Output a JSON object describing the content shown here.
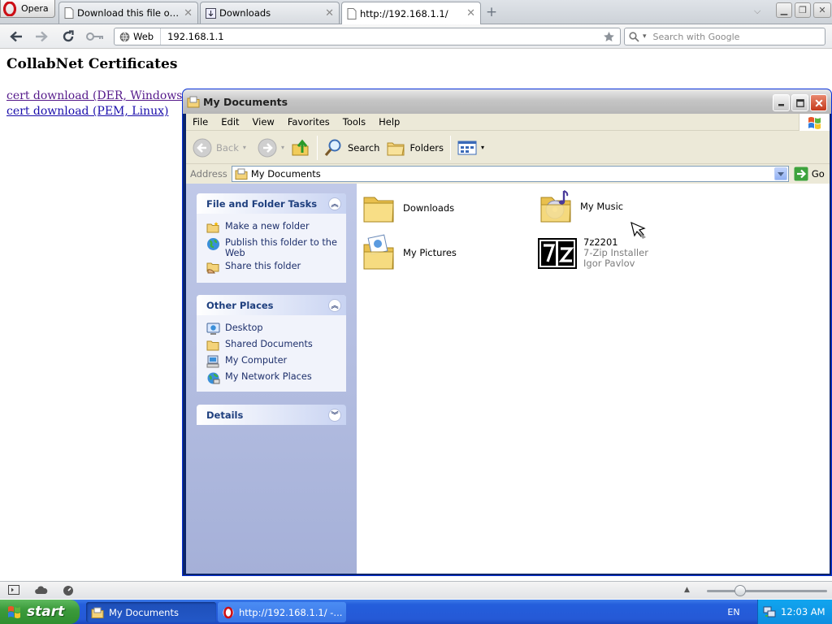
{
  "opera": {
    "menu_label": "Opera",
    "tabs": [
      {
        "title": "Download this file or upd..."
      },
      {
        "title": "Downloads"
      },
      {
        "title": "http://192.168.1.1/"
      }
    ],
    "address": {
      "web_label": "Web",
      "url": "192.168.1.1"
    },
    "search_placeholder": "Search with Google"
  },
  "page": {
    "title": "CollabNet Certificates",
    "links": [
      {
        "label": "cert download (DER, Windows)"
      },
      {
        "label": "cert download (PEM, Linux)"
      }
    ]
  },
  "explorer": {
    "title": "My Documents",
    "menu": [
      "File",
      "Edit",
      "View",
      "Favorites",
      "Tools",
      "Help"
    ],
    "toolbar": {
      "back": "Back",
      "search": "Search",
      "folders": "Folders"
    },
    "address_label": "Address",
    "address_value": "My Documents",
    "go_label": "Go",
    "tasks_panel": {
      "file_folder_tasks": {
        "title": "File and Folder Tasks",
        "items": [
          "Make a new folder",
          "Publish this folder to the Web",
          "Share this folder"
        ]
      },
      "other_places": {
        "title": "Other Places",
        "items": [
          "Desktop",
          "Shared Documents",
          "My Computer",
          "My Network Places"
        ]
      },
      "details": {
        "title": "Details"
      }
    },
    "items": [
      {
        "name": "Downloads",
        "icon": "folder-icon"
      },
      {
        "name": "My Music",
        "icon": "music-folder-icon"
      },
      {
        "name": "My Pictures",
        "icon": "pictures-folder-icon"
      },
      {
        "name": "7z2201",
        "line2": "7-Zip Installer",
        "line3": "Igor Pavlov",
        "icon": "7zip-installer-icon"
      }
    ]
  },
  "taskbar": {
    "start_label": "start",
    "tasks": [
      {
        "label": "My Documents"
      },
      {
        "label": "http://192.168.1.1/ -..."
      }
    ],
    "language": "EN",
    "clock": "12:03 AM"
  }
}
